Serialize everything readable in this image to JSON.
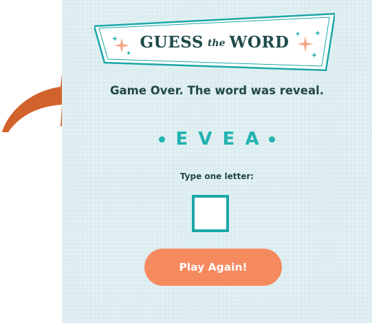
{
  "colors": {
    "panel_background": "#dcedf0",
    "accent_teal": "#22b2b0",
    "dark_text": "#21474a",
    "button_orange": "#f68a5f",
    "arrow_orange": "#d2622c",
    "sparkle_salmon": "#f4a68a"
  },
  "header": {
    "title_part1": "GUESS",
    "title_part2": "the",
    "title_part3": "WORD"
  },
  "game": {
    "message": "Game Over. The word was reveal.",
    "revealed_letters": [
      "E",
      "V",
      "E",
      "A"
    ],
    "input_label": "Type one letter:",
    "input_value": "",
    "play_again_label": "Play Again!"
  },
  "icons": {
    "arrow": "curved-arrow-icon",
    "sparkle": "sparkle-icon",
    "dot": "bullet-dot-icon"
  }
}
